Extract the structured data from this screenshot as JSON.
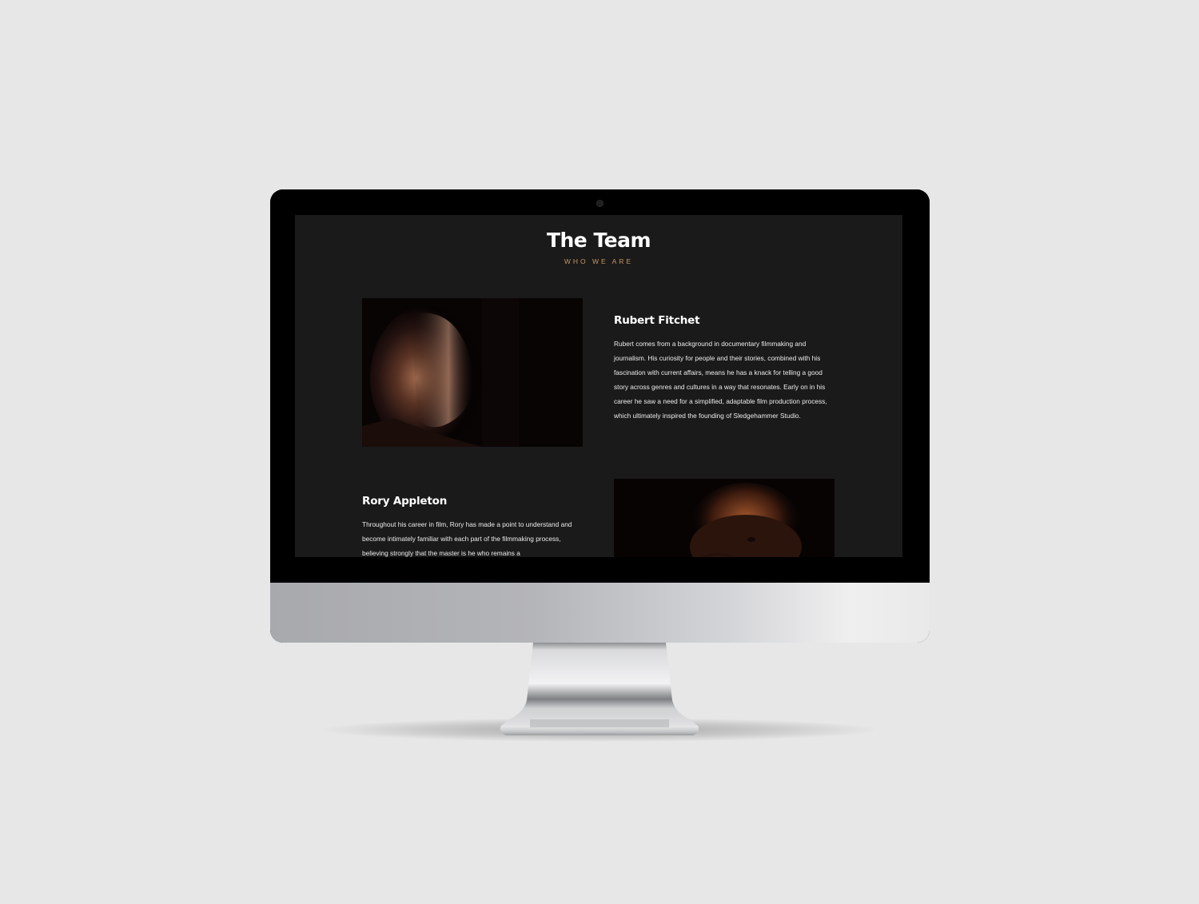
{
  "section": {
    "title": "The Team",
    "subtitle": "WHO WE ARE"
  },
  "members": [
    {
      "name": "Rubert Fitchet",
      "bio": "Rubert comes from a background in documentary filmmaking and journalism. His curiosity for people and their stories, combined with his fascination with current affairs, means he has a knack for telling a good story across genres and cultures in a way that resonates. Early on in his career he saw a need for a simplified, adaptable film production process, which ultimately inspired the founding of Sledgehammer Studio."
    },
    {
      "name": "Rory Appleton",
      "bio": "Throughout his career in film, Rory has made a point to understand and become intimately familiar with each part of the filmmaking process, believing strongly that the master is he who remains a"
    }
  ],
  "colors": {
    "background": "#e6e7e6",
    "screen": "#1a1a1b",
    "accent": "#c8955c",
    "text": "#ffffff"
  }
}
